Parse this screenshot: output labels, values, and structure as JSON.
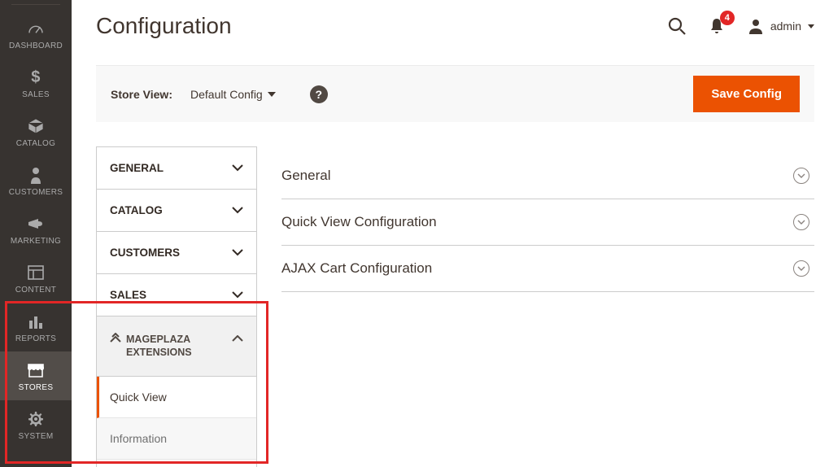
{
  "header": {
    "page_title": "Configuration",
    "notification_count": "4",
    "user_name": "admin"
  },
  "scope_bar": {
    "label": "Store View:",
    "value": "Default Config",
    "save_label": "Save Config"
  },
  "sidebar": {
    "items": [
      {
        "label": "DASHBOARD",
        "icon": "dashboard-icon"
      },
      {
        "label": "SALES",
        "icon": "dollar-icon"
      },
      {
        "label": "CATALOG",
        "icon": "box-icon"
      },
      {
        "label": "CUSTOMERS",
        "icon": "person-icon"
      },
      {
        "label": "MARKETING",
        "icon": "megaphone-icon"
      },
      {
        "label": "CONTENT",
        "icon": "layout-icon"
      },
      {
        "label": "REPORTS",
        "icon": "reports-icon"
      },
      {
        "label": "STORES",
        "icon": "store-icon"
      },
      {
        "label": "SYSTEM",
        "icon": "gear-icon"
      }
    ]
  },
  "config_tabs": {
    "items": [
      {
        "label": "GENERAL"
      },
      {
        "label": "CATALOG"
      },
      {
        "label": "CUSTOMERS"
      },
      {
        "label": "SALES"
      }
    ],
    "group_label": "MAGEPLAZA EXTENSIONS",
    "sub_items": [
      {
        "label": "Quick View",
        "active": true
      },
      {
        "label": "Information",
        "active": false
      }
    ]
  },
  "sections": [
    {
      "title": "General"
    },
    {
      "title": "Quick View Configuration"
    },
    {
      "title": "AJAX Cart Configuration"
    }
  ]
}
